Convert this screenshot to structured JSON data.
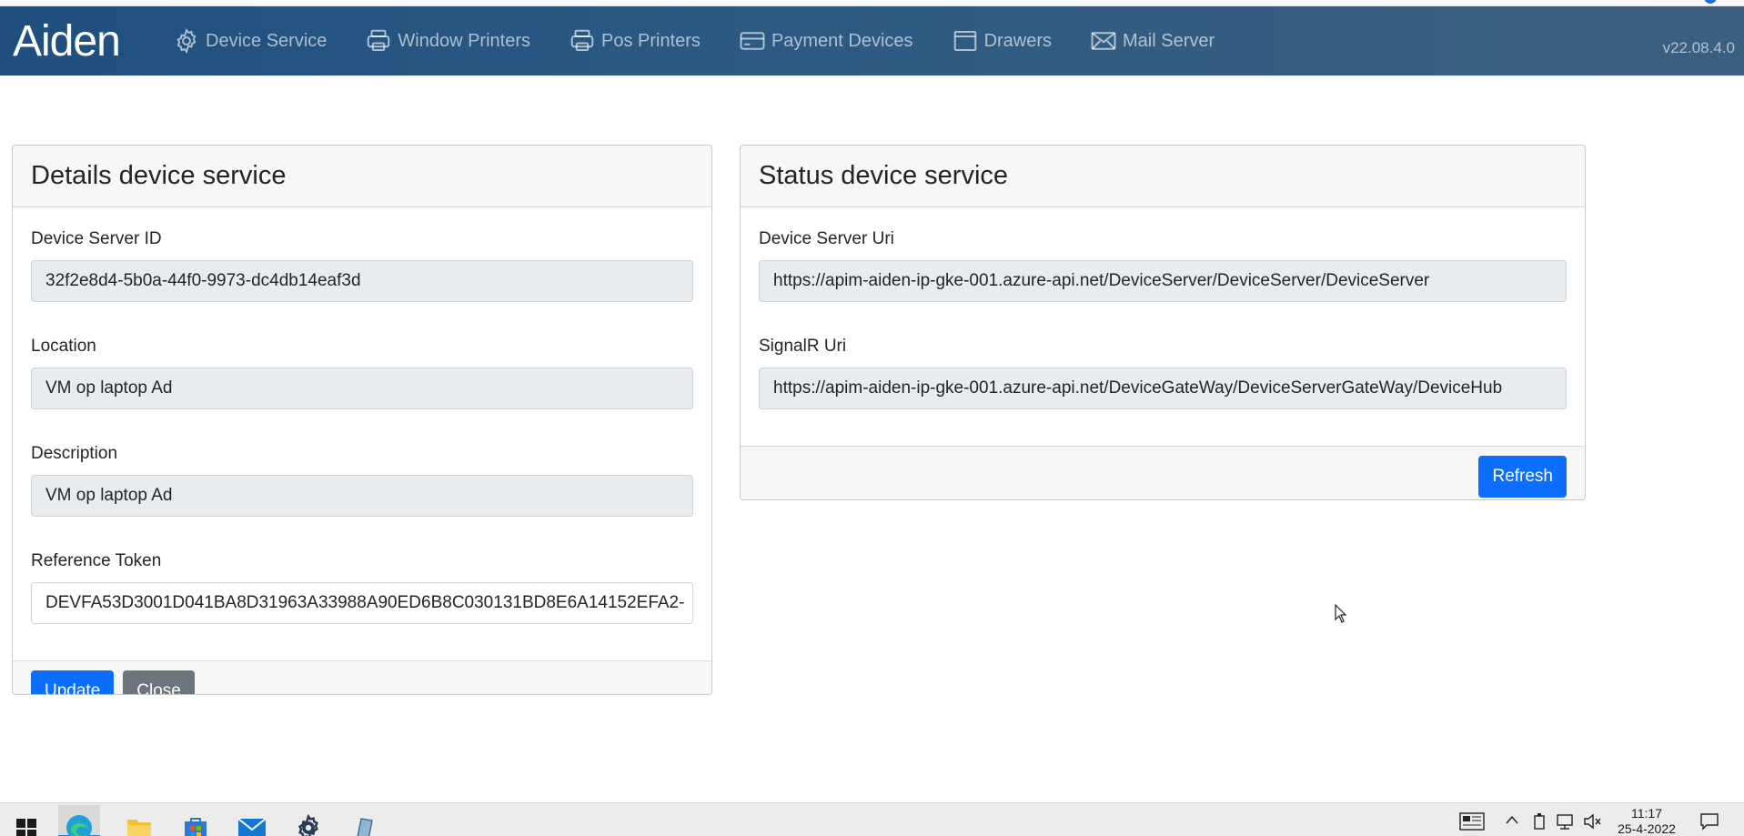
{
  "brand": {
    "name": "Aiden"
  },
  "nav": {
    "items": [
      {
        "label": "Device Service",
        "icon": "gear-icon"
      },
      {
        "label": "Window Printers",
        "icon": "printer-icon"
      },
      {
        "label": "Pos Printers",
        "icon": "printer-icon"
      },
      {
        "label": "Payment Devices",
        "icon": "credit-card-icon"
      },
      {
        "label": "Drawers",
        "icon": "drawer-icon"
      },
      {
        "label": "Mail Server",
        "icon": "envelope-icon"
      }
    ],
    "version": "v22.08.4.0"
  },
  "details": {
    "title": "Details device service",
    "fields": [
      {
        "label": "Device Server ID",
        "value": "32f2e8d4-5b0a-44f0-9973-dc4db14eaf3d"
      },
      {
        "label": "Location",
        "value": "VM op laptop Ad"
      },
      {
        "label": "Description",
        "value": "VM op laptop Ad"
      },
      {
        "label": "Reference Token",
        "value": "DEVFA53D3001D041BA8D31963A33988A90ED6B8C030131BD8E6A14152EFA2-"
      }
    ],
    "update_label": "Update",
    "close_label": "Close"
  },
  "status": {
    "title": "Status device service",
    "fields": [
      {
        "label": "Device Server Uri",
        "value": "https://apim-aiden-ip-gke-001.azure-api.net/DeviceServer/DeviceServer/DeviceServer"
      },
      {
        "label": "SignalR Uri",
        "value": "https://apim-aiden-ip-gke-001.azure-api.net/DeviceGateWay/DeviceServerGateWay/DeviceHub"
      }
    ],
    "refresh_label": "Refresh"
  },
  "taskbar": {
    "time": "11:17",
    "date": "25-4-2022"
  },
  "colors": {
    "navbar": "#2c5a84",
    "primary": "#0d6efd",
    "secondary": "#6c757d"
  }
}
